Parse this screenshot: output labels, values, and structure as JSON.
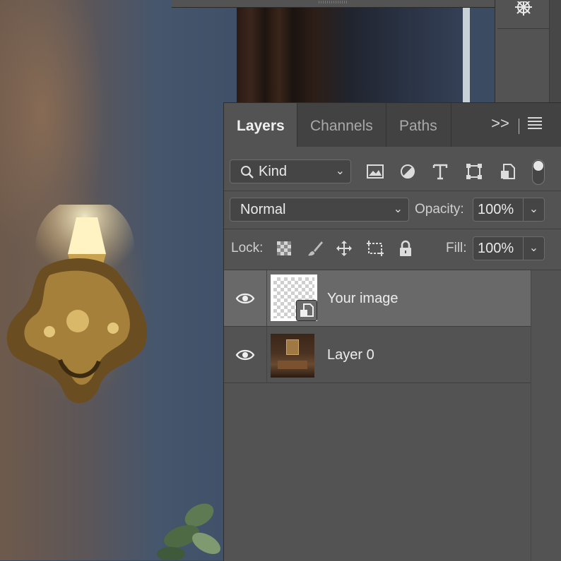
{
  "panel": {
    "tabs": [
      {
        "label": "Layers",
        "active": true
      },
      {
        "label": "Channels",
        "active": false
      },
      {
        "label": "Paths",
        "active": false
      }
    ],
    "more_glyph": ">>"
  },
  "filter": {
    "kind_label": "Kind",
    "icons": [
      "image-filter-icon",
      "adjustment-filter-icon",
      "type-filter-icon",
      "shape-filter-icon",
      "smart-object-filter-icon"
    ]
  },
  "blend": {
    "mode": "Normal",
    "opacity_label": "Opacity:",
    "opacity_value": "100%"
  },
  "lock": {
    "label": "Lock:",
    "icons": [
      "lock-transparent-pixels-icon",
      "lock-image-pixels-icon",
      "lock-position-icon",
      "lock-artboard-icon",
      "lock-all-icon"
    ],
    "fill_label": "Fill:",
    "fill_value": "100%"
  },
  "layers": [
    {
      "name": "Your image",
      "visible": true,
      "selected": true,
      "type": "smart-object"
    },
    {
      "name": "Layer 0",
      "visible": true,
      "selected": false,
      "type": "pixel"
    }
  ],
  "colors": {
    "panel_bg": "#535353",
    "tab_bar_bg": "#424242",
    "selected_row": "#696969",
    "text": "#ececec"
  }
}
